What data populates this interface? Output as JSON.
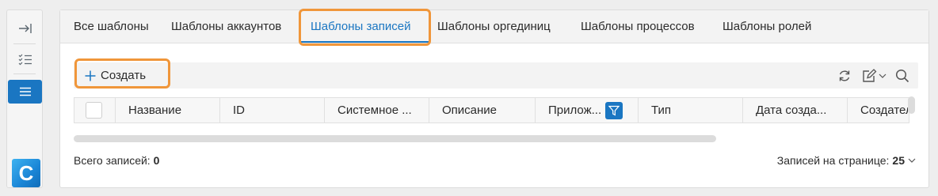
{
  "tabs": [
    {
      "label": "Все шаблоны",
      "active": false
    },
    {
      "label": "Шаблоны аккаунтов",
      "active": false
    },
    {
      "label": "Шаблоны записей",
      "active": true
    },
    {
      "label": "Шаблоны оргединиц",
      "active": false
    },
    {
      "label": "Шаблоны процессов",
      "active": false
    },
    {
      "label": "Шаблоны ролей",
      "active": false
    }
  ],
  "toolbar": {
    "create_label": "Создать",
    "icons": [
      "refresh-icon",
      "edit-icon",
      "chevron-down-icon",
      "search-icon"
    ]
  },
  "grid": {
    "columns": [
      "Название",
      "ID",
      "Системное ...",
      "Описание",
      "Прилож...",
      "Тип",
      "Дата созда...",
      "Создател"
    ],
    "rows": []
  },
  "footer": {
    "total_label": "Всего записей:",
    "total_value": "0",
    "per_page_label": "Записей на странице:",
    "per_page_value": "25"
  },
  "logo_letter": "C",
  "colors": {
    "accent": "#1a76c2",
    "highlight": "#f0963a"
  }
}
